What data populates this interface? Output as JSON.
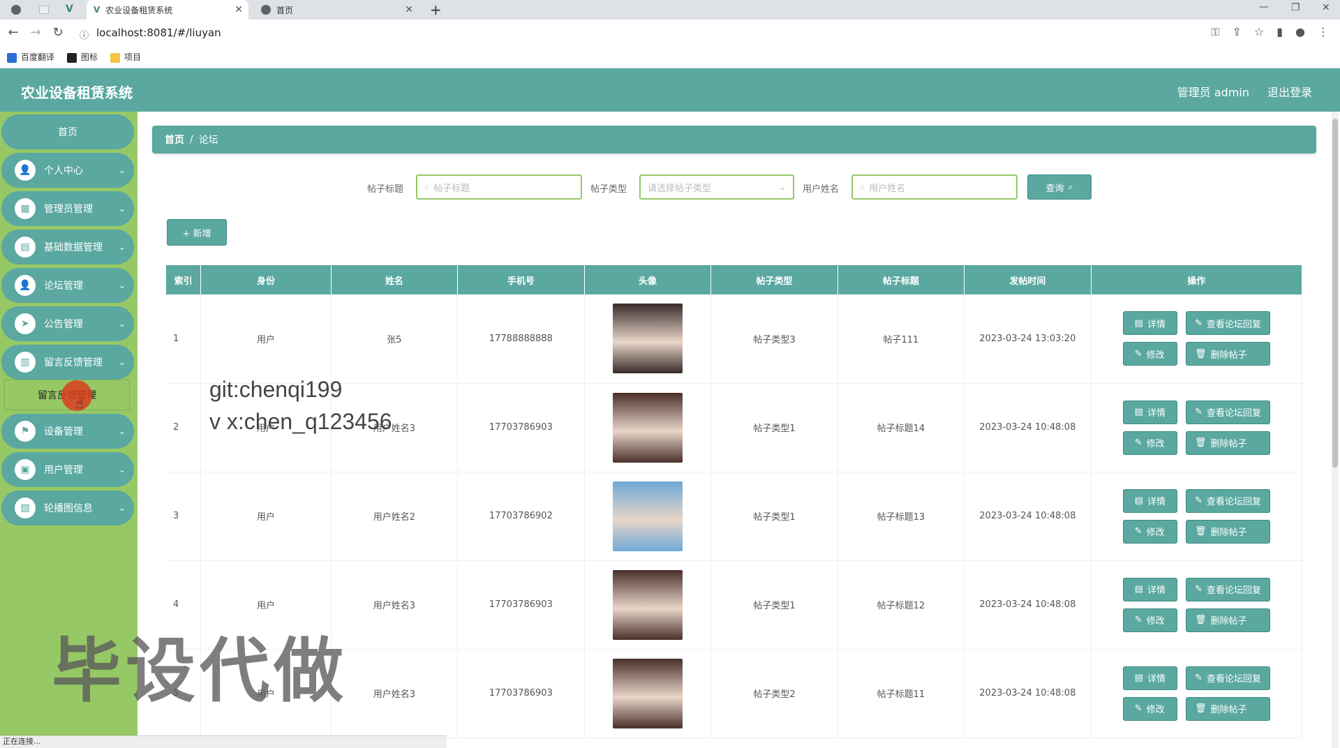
{
  "browser": {
    "tabs": [
      {
        "label": "农业设备租赁系统",
        "active": true
      },
      {
        "label": "首页",
        "active": false
      }
    ],
    "url": "localhost:8081/#/liuyan",
    "bookmarks": [
      "百度翻译",
      "图标",
      "项目"
    ],
    "status": "正在连接..."
  },
  "header": {
    "title": "农业设备租赁系统",
    "user": "管理员 admin",
    "logout": "退出登录"
  },
  "sidebar": {
    "home": "首页",
    "items": [
      {
        "label": "个人中心",
        "icon": "user-icon"
      },
      {
        "label": "管理员管理",
        "icon": "grid-icon"
      },
      {
        "label": "基础数据管理",
        "icon": "chart-icon"
      },
      {
        "label": "论坛管理",
        "icon": "user-icon"
      },
      {
        "label": "公告管理",
        "icon": "send-icon"
      },
      {
        "label": "留言反馈管理",
        "icon": "book-icon"
      },
      {
        "label": "设备管理",
        "icon": "flag-icon"
      },
      {
        "label": "用户管理",
        "icon": "briefcase-icon"
      },
      {
        "label": "轮播图信息",
        "icon": "clipboard-icon"
      }
    ],
    "submenu": "留言反馈管理"
  },
  "breadcrumb": {
    "home": "首页",
    "sep": "/",
    "current": "论坛"
  },
  "search": {
    "title_label": "帖子标题",
    "title_placeholder": "帖子标题",
    "type_label": "帖子类型",
    "type_placeholder": "请选择帖子类型",
    "name_label": "用户姓名",
    "name_placeholder": "用户姓名",
    "query": "查询"
  },
  "add_label": "+ 新增",
  "table": {
    "columns": [
      "索引",
      "身份",
      "姓名",
      "手机号",
      "头像",
      "帖子类型",
      "帖子标题",
      "发帖时间",
      "操作"
    ],
    "rows": [
      {
        "idx": "1",
        "role": "用户",
        "name": "张5",
        "phone": "17788888888",
        "type": "帖子类型3",
        "title": "帖子111",
        "time": "2023-03-24 13:03:20",
        "avatar": "#3a2a2a"
      },
      {
        "idx": "2",
        "role": "用户",
        "name": "用户姓名3",
        "phone": "17703786903",
        "type": "帖子类型1",
        "title": "帖子标题14",
        "time": "2023-03-24 10:48:08",
        "avatar": "#4a2f2a"
      },
      {
        "idx": "3",
        "role": "用户",
        "name": "用户姓名2",
        "phone": "17703786902",
        "type": "帖子类型1",
        "title": "帖子标题13",
        "time": "2023-03-24 10:48:08",
        "avatar": "#6fa8d8"
      },
      {
        "idx": "4",
        "role": "用户",
        "name": "用户姓名3",
        "phone": "17703786903",
        "type": "帖子类型1",
        "title": "帖子标题12",
        "time": "2023-03-24 10:48:08",
        "avatar": "#4a2f2a"
      },
      {
        "idx": "5",
        "role": "用户",
        "name": "用户姓名3",
        "phone": "17703786903",
        "type": "帖子类型2",
        "title": "帖子标题11",
        "time": "2023-03-24 10:48:08",
        "avatar": "#4a2f2a"
      }
    ],
    "actions": {
      "detail": "详情",
      "view_reply": "查看论坛回复",
      "edit": "修改",
      "delete": "删除帖子"
    }
  },
  "watermark": {
    "line1": "git:chenqi199",
    "line2": "v x:chen_q123456",
    "big": "毕设代做"
  }
}
